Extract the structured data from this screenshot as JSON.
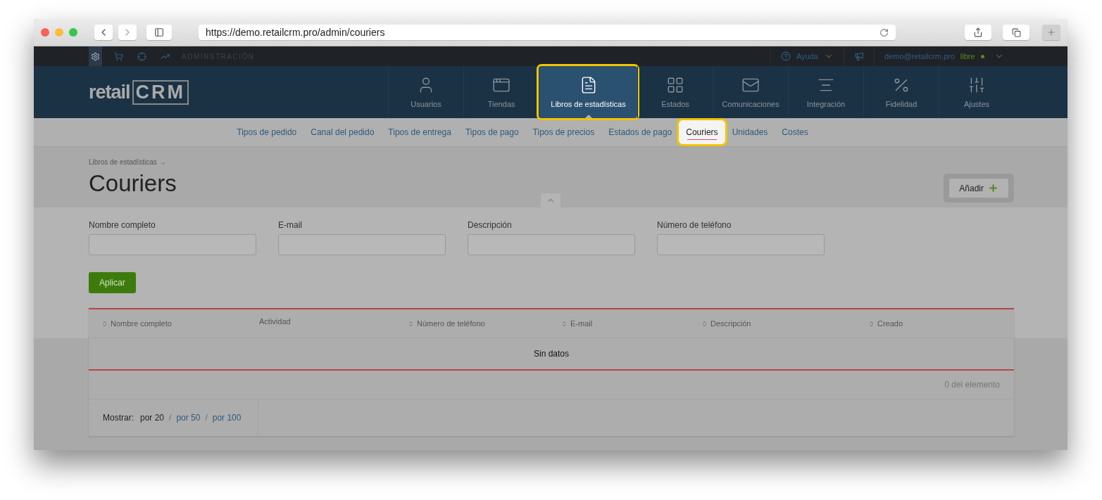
{
  "browser": {
    "url": "https://demo.retailcrm.pro/admin/couriers"
  },
  "top_bar": {
    "section": "ADMINSTRACIÓN",
    "help": "Ayuda",
    "account": "demo@retailcrm.pro",
    "plan": "libre"
  },
  "logo": {
    "text": "retail",
    "mark": "CRM"
  },
  "nav": [
    {
      "label": "Usuarios",
      "selected": false
    },
    {
      "label": "Tiendas",
      "selected": false
    },
    {
      "label": "Libros de estadísticas",
      "selected": true
    },
    {
      "label": "Estados",
      "selected": false
    },
    {
      "label": "Comunicaciones",
      "selected": false
    },
    {
      "label": "Integración",
      "selected": false
    },
    {
      "label": "Fidelidad",
      "selected": false
    },
    {
      "label": "Ajustes",
      "selected": false
    }
  ],
  "subnav": [
    {
      "label": "Tipos de pedido",
      "selected": false
    },
    {
      "label": "Canal del pedido",
      "selected": false
    },
    {
      "label": "Tipos de entrega",
      "selected": false
    },
    {
      "label": "Tipos de pago",
      "selected": false
    },
    {
      "label": "Tipos de precios",
      "selected": false
    },
    {
      "label": "Estados de pago",
      "selected": false
    },
    {
      "label": "Couriers",
      "selected": true
    },
    {
      "label": "Unidades",
      "selected": false
    },
    {
      "label": "Costes",
      "selected": false
    }
  ],
  "breadcrumb": "Libros de estadísticas →",
  "title": "Couriers",
  "add_button": "Añadir",
  "filters": [
    {
      "label": "Nombre completo"
    },
    {
      "label": "E-mail"
    },
    {
      "label": "Descripción"
    },
    {
      "label": "Número de teléfono"
    }
  ],
  "apply_button": "Aplicar",
  "table": {
    "columns": [
      {
        "label": "Nombre completo",
        "sortable": true
      },
      {
        "label": "Actividad",
        "sortable": false
      },
      {
        "label": "Número de teléfono",
        "sortable": true
      },
      {
        "label": "E-mail",
        "sortable": true
      },
      {
        "label": "Descripción",
        "sortable": true
      },
      {
        "label": "Creado",
        "sortable": true
      }
    ],
    "empty": "Sin datos",
    "count": "0 del elemento"
  },
  "pagination": {
    "label": "Mostrar:",
    "separator": "/",
    "options": [
      {
        "label": "por 20",
        "selected": true
      },
      {
        "label": "por 50",
        "selected": false
      },
      {
        "label": "por 100",
        "selected": false
      }
    ]
  }
}
